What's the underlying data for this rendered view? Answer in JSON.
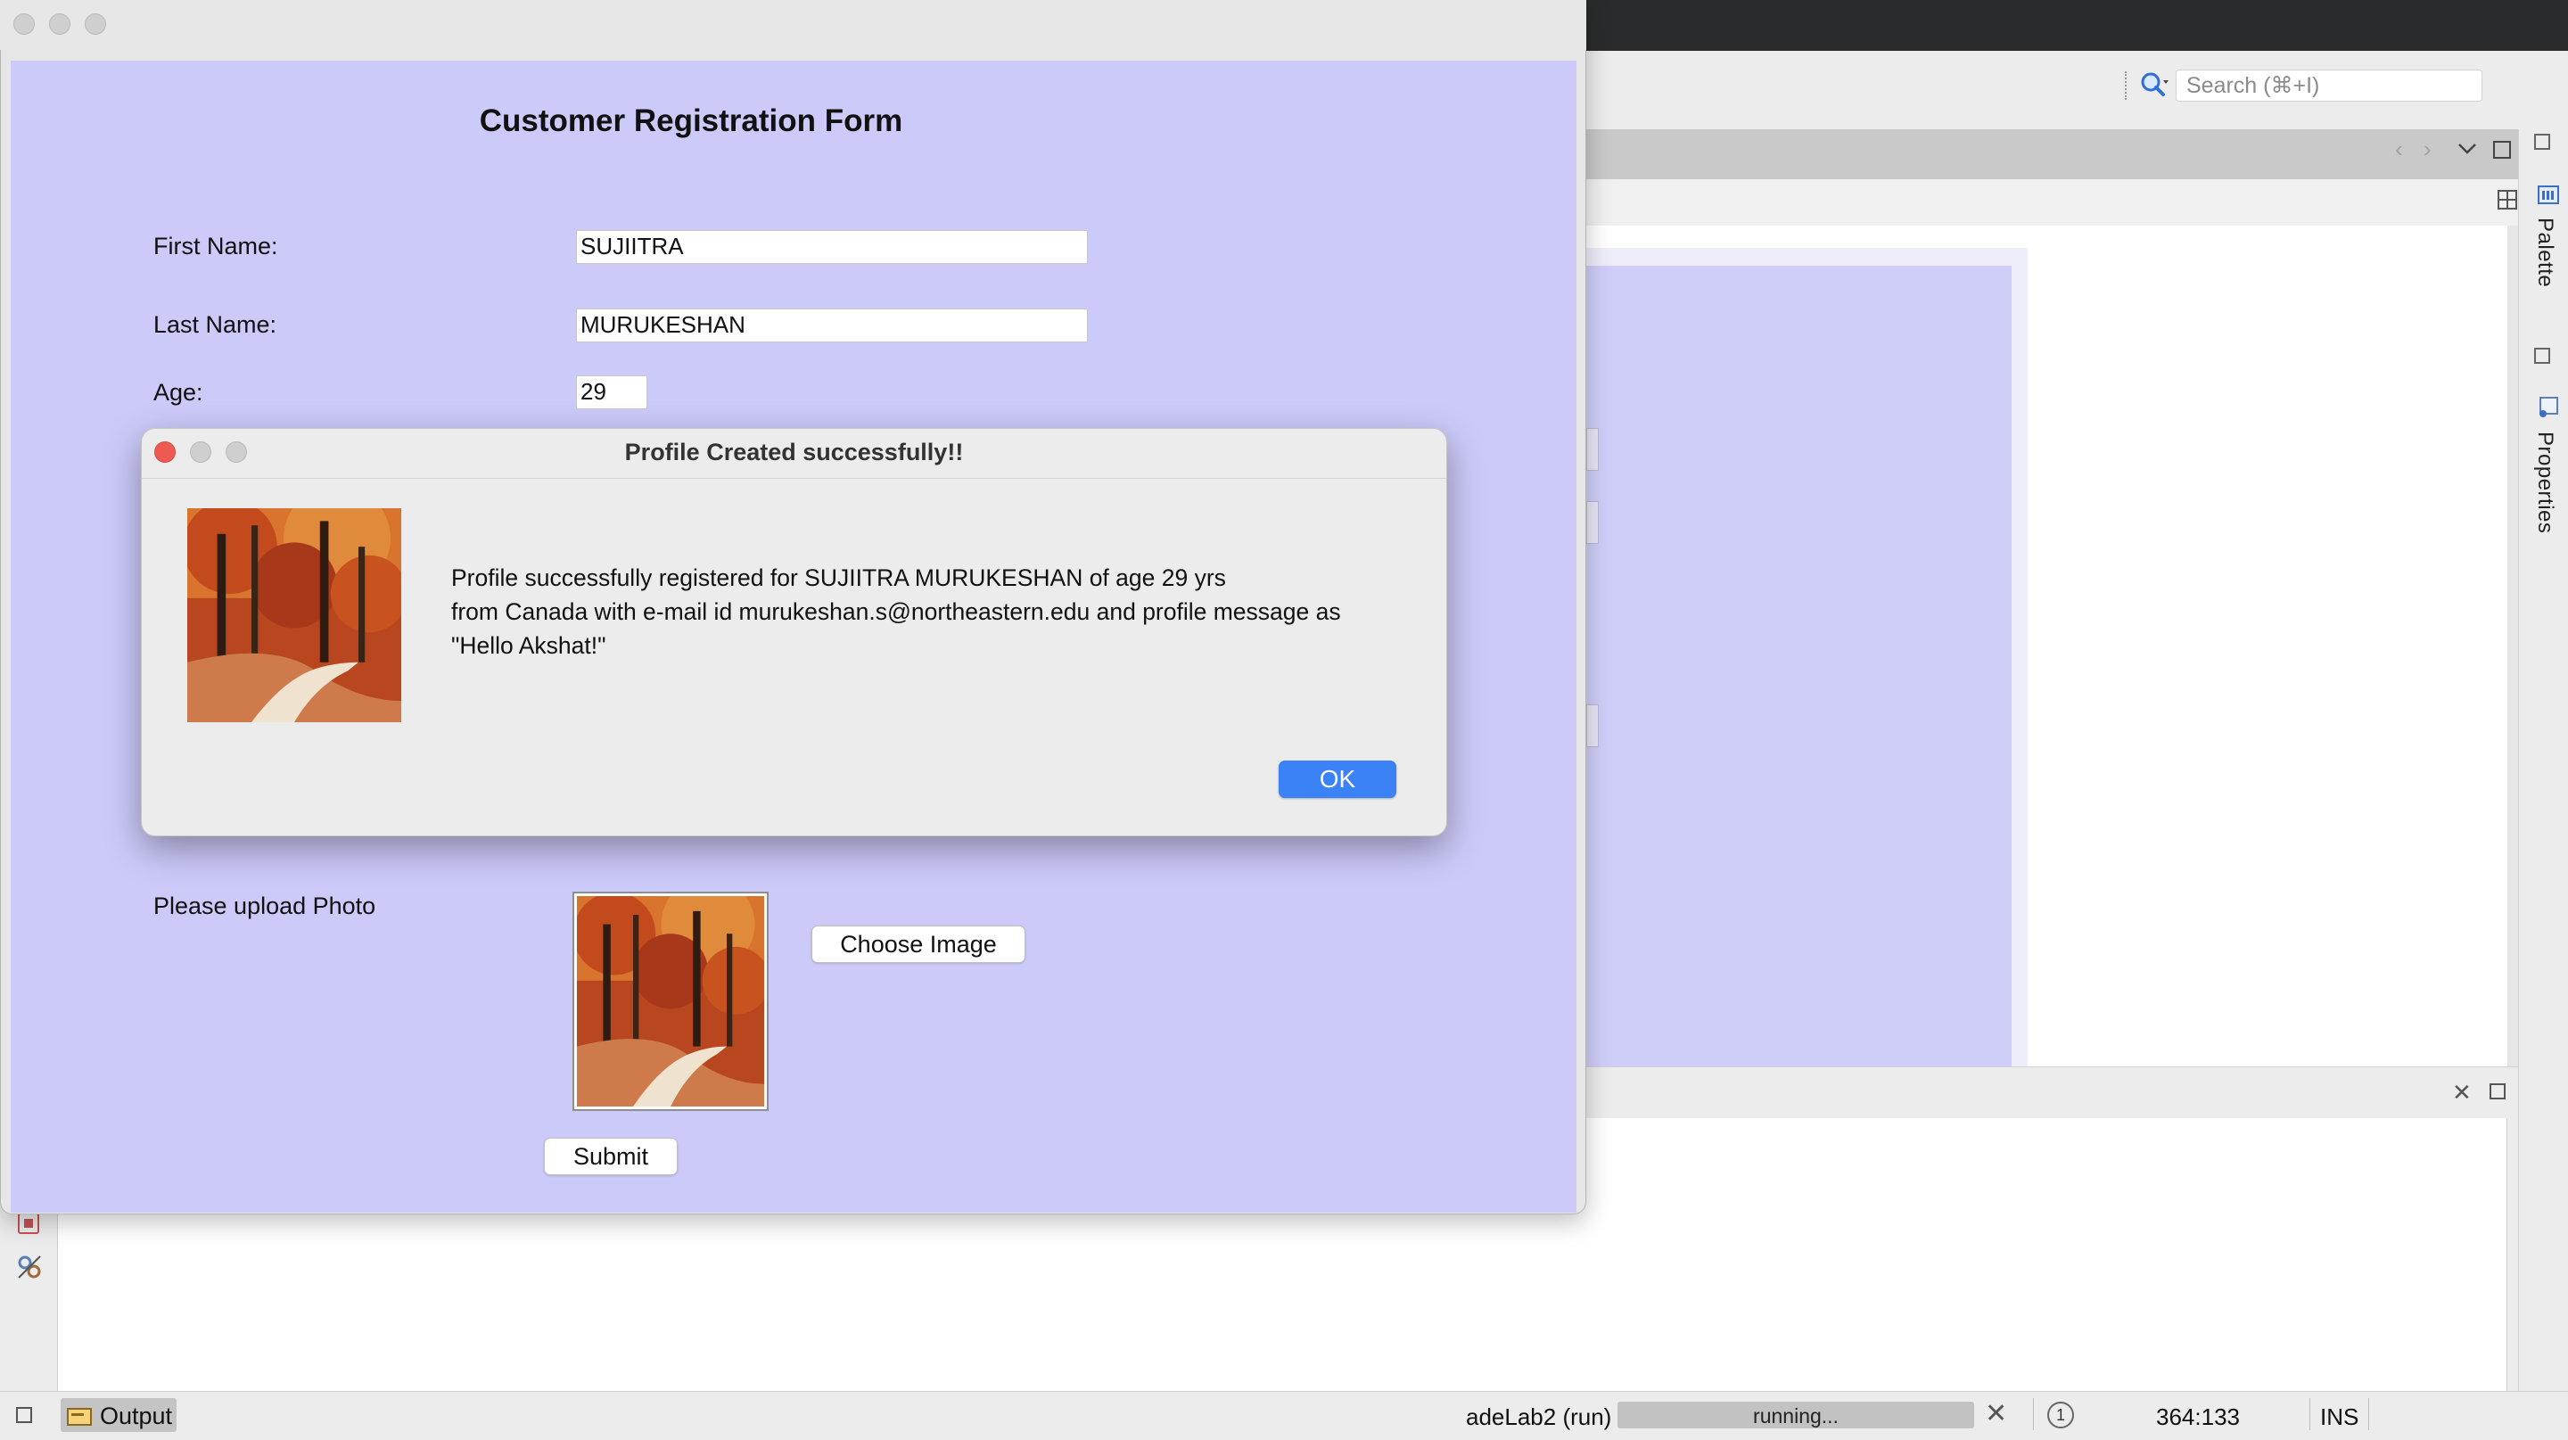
{
  "ide": {
    "search_placeholder": "Search (⌘+I)",
    "palette_label": "Palette",
    "properties_label": "Properties",
    "status": {
      "output_tab": "Output",
      "run_label": "adeLab2 (run)",
      "progress_text": "running...",
      "notifications": "1",
      "caret_position": "364:133",
      "insert_mode": "INS"
    }
  },
  "form": {
    "title": "Customer Registration Form",
    "first_name_label": "First Name:",
    "first_name_value": "SUJIITRA",
    "last_name_label": "Last Name:",
    "last_name_value": "MURUKESHAN",
    "age_label": "Age:",
    "age_value": "29",
    "photo_label": "Please upload Photo",
    "choose_image_label": "Choose Image",
    "submit_label": "Submit"
  },
  "dialog": {
    "title": "Profile Created successfully!!",
    "message_lines": [
      "Profile successfully registered for SUJIITRA MURUKESHAN of age 29 yrs",
      "from Canada with e-mail id murukeshan.s@northeastern.edu and profile message as",
      "\"Hello Akshat!\""
    ],
    "ok_label": "OK"
  },
  "colors": {
    "form_background": "#cbcaf9",
    "ok_button": "#3b82f6",
    "close_red": "#ee5a52"
  }
}
